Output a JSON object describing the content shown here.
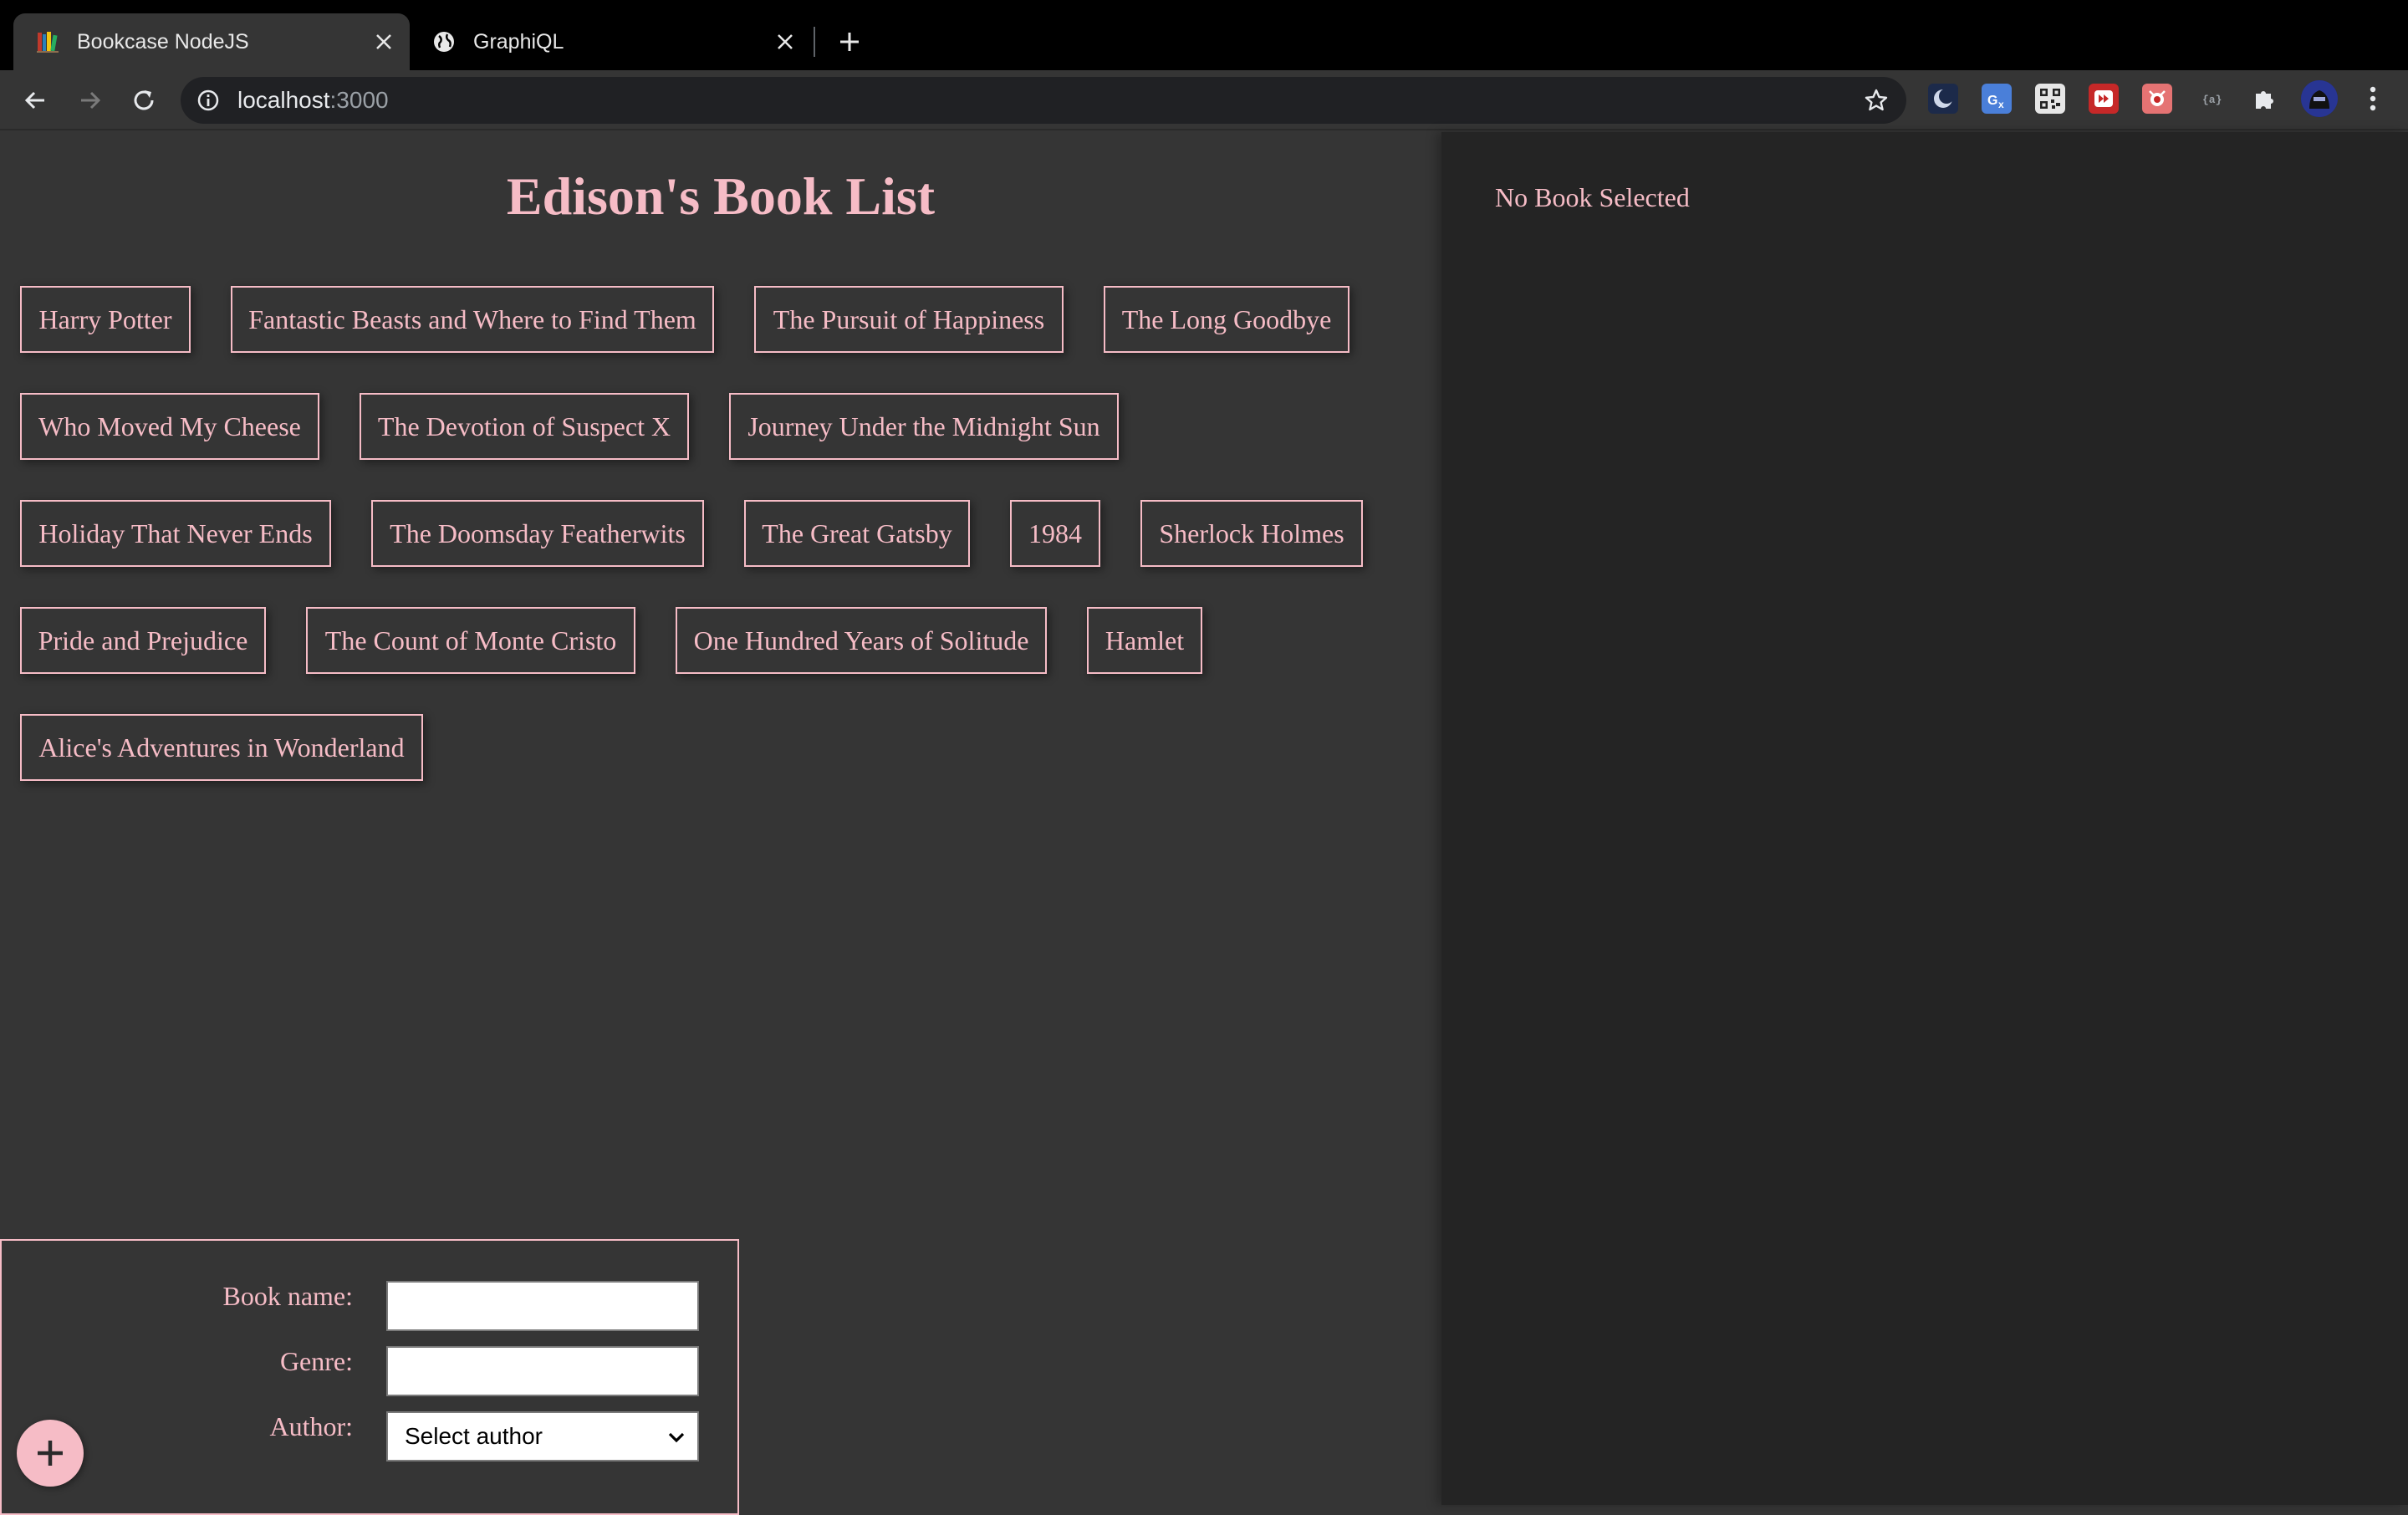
{
  "browser": {
    "tabs": [
      {
        "title": "Bookcase NodeJS",
        "active": true,
        "favicon": "books-icon"
      },
      {
        "title": "GraphiQL",
        "active": false,
        "favicon": "globe-icon"
      }
    ],
    "url": {
      "host": "localhost",
      "port": ":3000"
    }
  },
  "page": {
    "heading": "Edison's Book List",
    "books": [
      "Harry Potter",
      "Fantastic Beasts and Where to Find Them",
      "The Pursuit of Happiness",
      "The Long Goodbye",
      "Who Moved My Cheese",
      "The Devotion of Suspect X",
      "Journey Under the Midnight Sun",
      "Holiday That Never Ends",
      "The Doomsday Featherwits",
      "The Great Gatsby",
      "1984",
      "Sherlock Holmes",
      "Pride and Prejudice",
      "The Count of Monte Cristo",
      "One Hundred Years of Solitude",
      "Hamlet",
      "Alice's Adventures in Wonderland"
    ],
    "details_placeholder": "No Book Selected",
    "form": {
      "book_name_label": "Book name:",
      "book_name_value": "",
      "genre_label": "Genre:",
      "genre_value": "",
      "author_label": "Author:",
      "author_selected": "Select author",
      "add_button_icon": "plus-icon"
    }
  },
  "colors": {
    "accent": "#f6bcc6",
    "main_bg": "#353535",
    "side_bg": "#242424"
  }
}
